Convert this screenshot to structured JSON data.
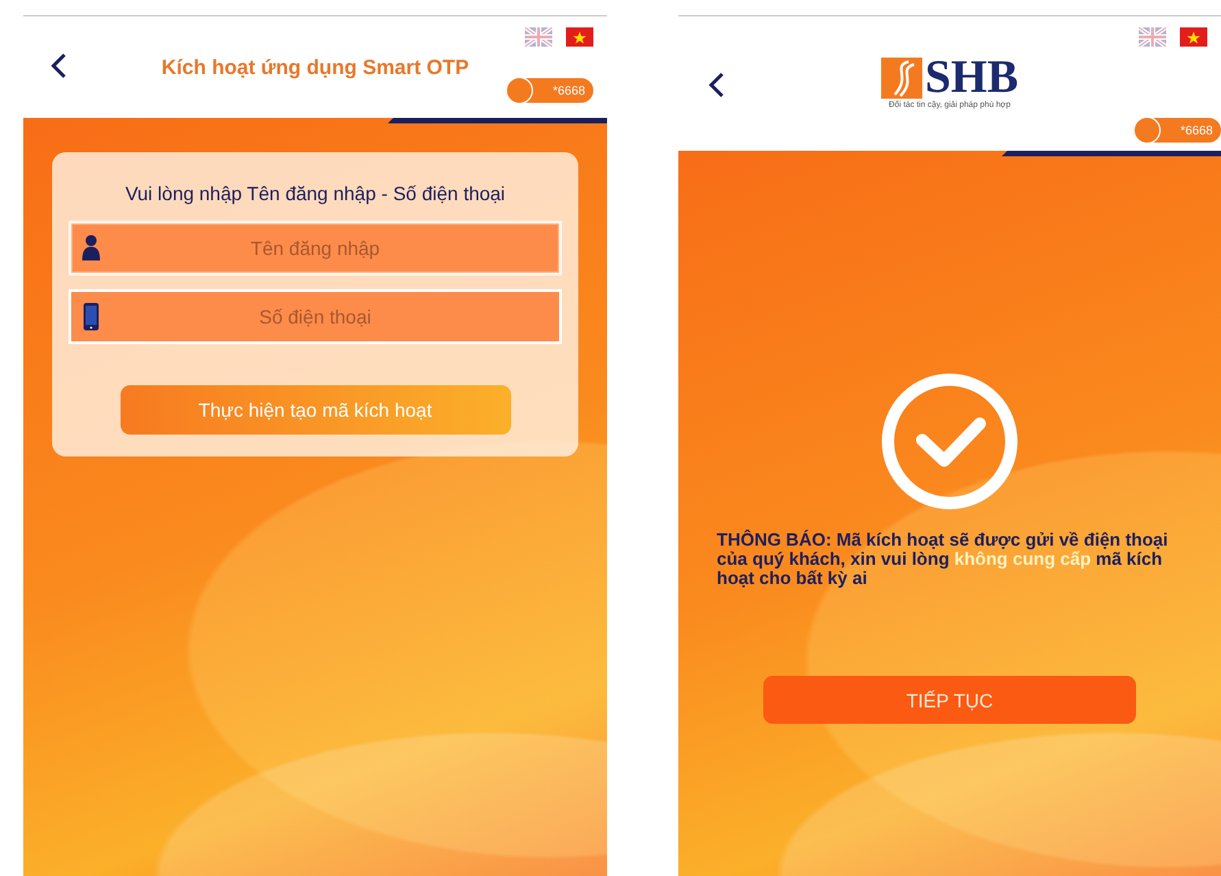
{
  "screens": [
    {
      "kind": "form",
      "header": {
        "title": "Kích hoạt ứng dụng Smart OTP"
      },
      "languages": [
        {
          "kind": "uk",
          "selected": false
        },
        {
          "kind": "vn",
          "selected": true
        }
      ],
      "hotline": "*6668",
      "card": {
        "title": "Vui lòng nhập Tên đăng nhập - Số điện thoại",
        "fields": [
          {
            "kind": "user",
            "placeholder": "Tên đăng nhập",
            "focused": true
          },
          {
            "kind": "phone",
            "placeholder": "Số điện thoại",
            "focused": false
          }
        ],
        "button": "Thực hiện tạo mã kích hoạt"
      }
    },
    {
      "kind": "notice",
      "header": {
        "logo": "SHB",
        "tagline": "Đối tác tin cậy, giải pháp phù hợp"
      },
      "languages": [
        {
          "kind": "uk",
          "selected": false
        },
        {
          "kind": "vn",
          "selected": true
        }
      ],
      "hotline": "*6668",
      "notice": [
        {
          "text": "THÔNG BÁO: Mã kích hoạt sẽ được gửi về điện thoại của quý khách, xin vui lòng ",
          "highlight": false
        },
        {
          "text": "không cung cấp",
          "highlight": true
        },
        {
          "text": " mã kích hoạt cho bất kỳ ai",
          "highlight": false
        }
      ],
      "button": "TIẾP TỤC"
    }
  ]
}
